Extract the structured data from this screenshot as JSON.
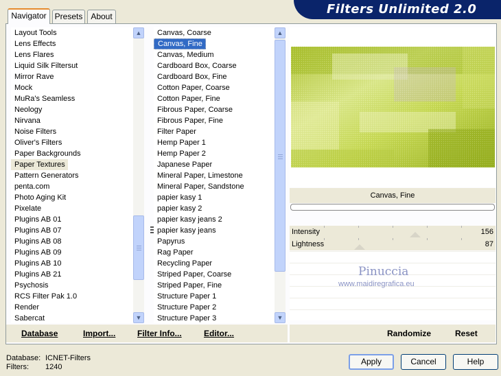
{
  "tabs": [
    {
      "label": "Navigator"
    },
    {
      "label": "Presets"
    },
    {
      "label": "About"
    }
  ],
  "banner": {
    "title": "Filters Unlimited 2.0"
  },
  "categories": {
    "items": [
      "Layout Tools",
      "Lens Effects",
      "Lens Flares",
      "Liquid Silk Filtersut",
      "Mirror Rave",
      "Mock",
      "MuRa's Seamless",
      "Neology",
      "Nirvana",
      "Noise Filters",
      "Oliver's Filters",
      "Paper Backgrounds",
      "Paper Textures",
      "Pattern Generators",
      "penta.com",
      "Photo Aging Kit",
      "Pixelate",
      "Plugins AB 01",
      "Plugins AB 07",
      "Plugins AB 08",
      "Plugins AB 09",
      "Plugins AB 10",
      "Plugins AB 21",
      "Psychosis",
      "RCS Filter Pak 1.0",
      "Render",
      "Sabercat"
    ],
    "highlighted": "Paper Textures"
  },
  "filters": {
    "items": [
      "Canvas, Coarse",
      "Canvas, Fine",
      "Canvas, Medium",
      "Cardboard Box, Coarse",
      "Cardboard Box, Fine",
      "Cotton Paper, Coarse",
      "Cotton Paper, Fine",
      "Fibrous Paper, Coarse",
      "Fibrous Paper, Fine",
      "Filter Paper",
      "Hemp Paper 1",
      "Hemp Paper 2",
      "Japanese Paper",
      "Mineral Paper, Limestone",
      "Mineral Paper, Sandstone",
      "papier kasy 1",
      "papier kasy 2",
      "papier kasy jeans 2",
      "papier kasy jeans",
      "Papyrus",
      "Rag Paper",
      "Recycling Paper",
      "Striped Paper, Coarse",
      "Striped Paper, Fine",
      "Structure Paper 1",
      "Structure Paper 2",
      "Structure Paper 3"
    ],
    "selected": "Canvas, Fine"
  },
  "preview": {
    "filter_name": "Canvas, Fine",
    "progress": 0
  },
  "sliders": [
    {
      "label": "Intensity",
      "value": "156",
      "level": 0.61
    },
    {
      "label": "Lightness",
      "value": "87",
      "level": 0.34
    }
  ],
  "watermark": {
    "line1": "Pinuccia",
    "line2": "www.maidiregrafica.eu"
  },
  "actions": {
    "database": "Database",
    "import": "Import...",
    "filter_info": "Filter Info...",
    "editor": "Editor...",
    "randomize": "Randomize",
    "reset": "Reset"
  },
  "status": {
    "database_label": "Database:",
    "database_value": "ICNET-Filters",
    "filters_label": "Filters:",
    "filters_value": "1240"
  },
  "buttons": {
    "apply": "Apply",
    "cancel": "Cancel",
    "help": "Help"
  },
  "colors": {
    "selection": "#316ac5",
    "banner": "#0a246a",
    "tab_accent": "#e68b2c"
  }
}
